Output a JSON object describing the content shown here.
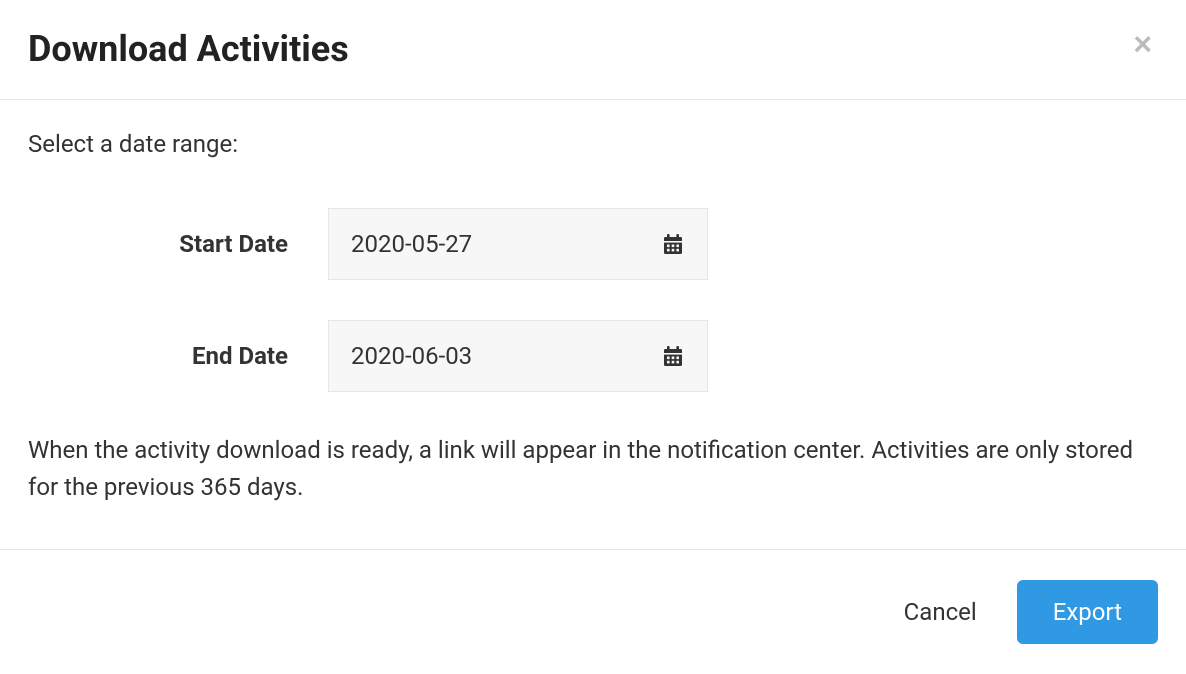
{
  "header": {
    "title": "Download Activities"
  },
  "body": {
    "prompt": "Select a date range:",
    "start_date": {
      "label": "Start Date",
      "value": "2020-05-27"
    },
    "end_date": {
      "label": "End Date",
      "value": "2020-06-03"
    },
    "helper_text": "When the activity download is ready, a link will appear in the notification center. Activities are only stored for the previous 365 days."
  },
  "footer": {
    "cancel_label": "Cancel",
    "export_label": "Export"
  },
  "colors": {
    "primary": "#2f99e3",
    "border": "#e5e5e5",
    "muted_icon": "#bbbbbb"
  }
}
